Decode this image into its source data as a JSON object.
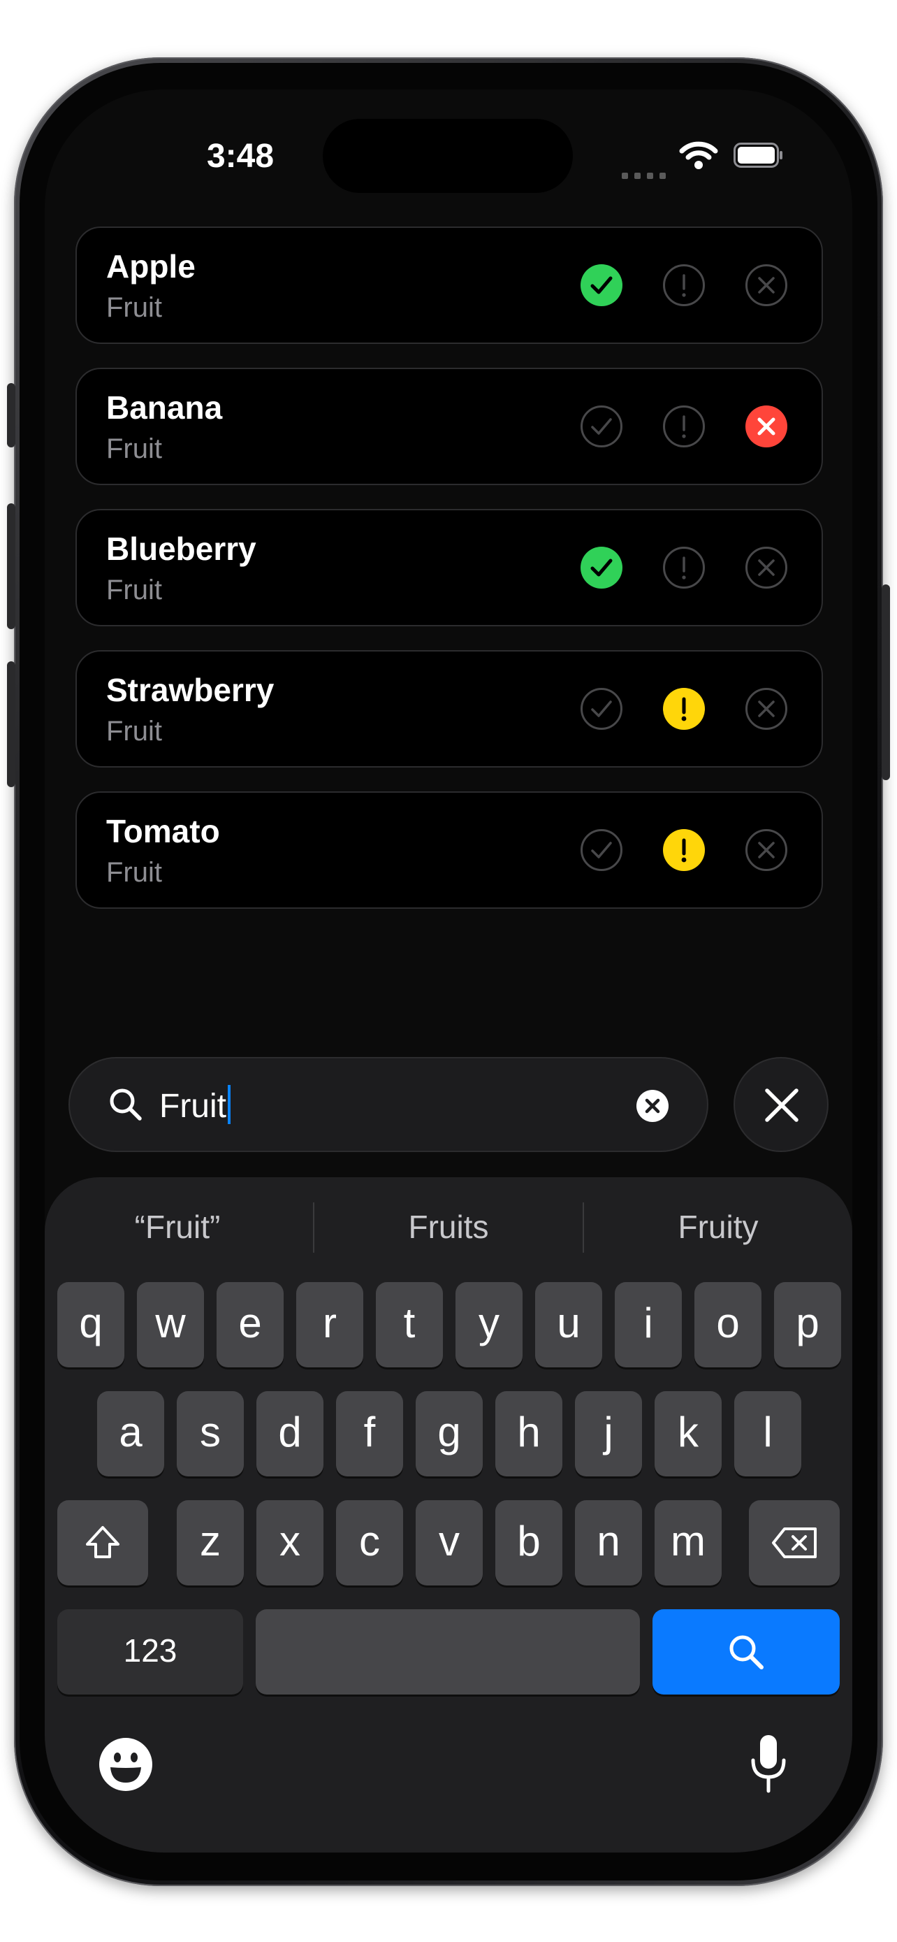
{
  "status_bar": {
    "time": "3:48"
  },
  "items": [
    {
      "title": "Apple",
      "subtitle": "Fruit",
      "state": "check"
    },
    {
      "title": "Banana",
      "subtitle": "Fruit",
      "state": "x"
    },
    {
      "title": "Blueberry",
      "subtitle": "Fruit",
      "state": "check"
    },
    {
      "title": "Strawberry",
      "subtitle": "Fruit",
      "state": "warn"
    },
    {
      "title": "Tomato",
      "subtitle": "Fruit",
      "state": "warn"
    }
  ],
  "status_colors": {
    "check": "#30d158",
    "warn": "#ffd60a",
    "x": "#ff453a",
    "inactive": "#48484a"
  },
  "search": {
    "query": "Fruit"
  },
  "keyboard": {
    "suggestions": [
      "“Fruit”",
      "Fruits",
      "Fruity"
    ],
    "row1": [
      "q",
      "w",
      "e",
      "r",
      "t",
      "y",
      "u",
      "i",
      "o",
      "p"
    ],
    "row2": [
      "a",
      "s",
      "d",
      "f",
      "g",
      "h",
      "j",
      "k",
      "l"
    ],
    "row3": [
      "z",
      "x",
      "c",
      "v",
      "b",
      "n",
      "m"
    ],
    "numbers_label": "123"
  }
}
